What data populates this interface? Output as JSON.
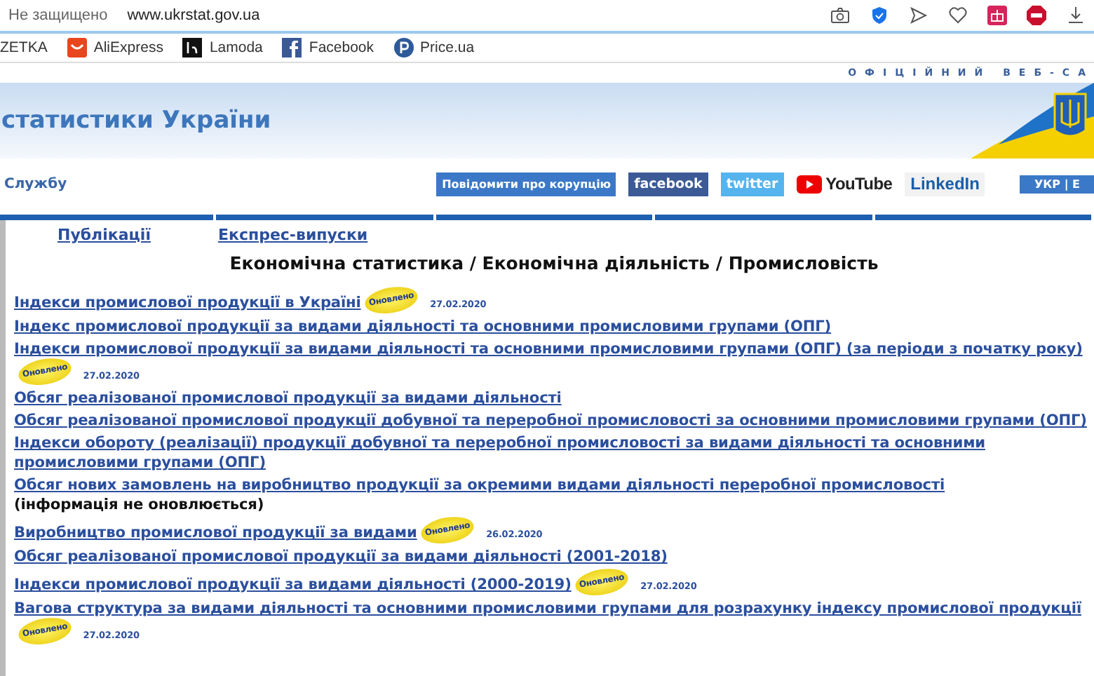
{
  "browser": {
    "security": "Не защищено",
    "url": "www.ukrstat.gov.ua",
    "bookmarks": [
      {
        "label": "ZETKA",
        "kind": "none"
      },
      {
        "label": "AliExpress",
        "kind": "ali"
      },
      {
        "label": "Lamoda",
        "kind": "lamoda"
      },
      {
        "label": "Facebook",
        "kind": "facebook"
      },
      {
        "label": "Price.ua",
        "kind": "price"
      }
    ]
  },
  "header": {
    "tagline": "ОФІЦІЙНИЙ ВЕБ-СА",
    "site_title": "статистики України",
    "service_link": "Службу",
    "social": [
      {
        "label": "Повідомити про корупцію",
        "kind": "corruption"
      },
      {
        "label": "facebook",
        "kind": "facebook"
      },
      {
        "label": "twitter",
        "kind": "twitter"
      },
      {
        "label": "YouTube",
        "kind": "youtube"
      },
      {
        "label": "LinkedIn",
        "kind": "linkedin"
      }
    ],
    "language": {
      "label": "УКР | Е",
      "selected": true
    }
  },
  "tabs": [
    {
      "label": "Публікації"
    },
    {
      "label": "Експрес-випуски"
    }
  ],
  "page_title": "Економічна статистика / Економічна діяльність / Промисловість",
  "items": [
    {
      "text": "Індекси промислової продукції в Україні",
      "badge": "Оновлено",
      "date": "27.02.2020"
    },
    {
      "text": "Індекс промислової продукції за видами діяльності та основними промисловими групами (ОПГ)"
    },
    {
      "text": "Індекси промислової продукції за видами діяльності та основними промисловими групами (ОПГ) (за періоди з початку року)",
      "badge": "Оновлено",
      "date": "27.02.2020"
    },
    {
      "text": "Обсяг реалізованої промислової продукції за видами діяльності"
    },
    {
      "text": "Обсяг реалізованої промислової продукції добувної та переробної промисловості за основними промисловими групами (ОПГ)"
    },
    {
      "text": "Індекси обороту (реалізації) продукції добувної та переробної промисловості за видами діяльності та основними промисловими групами (ОПГ)"
    },
    {
      "text": "Обсяг нових замовлень на виробництво продукції за окремими видами діяльності переробної промисловості",
      "note": "(інформація не оновлюється)"
    },
    {
      "text": "Виробництво промислової продукції за видами",
      "badge": "Оновлено",
      "date": "26.02.2020"
    },
    {
      "text": "Обсяг реалізованої промислової продукції за видами діяльності (2001-2018)"
    },
    {
      "text": "Індекси промислової продукції за видами діяльності (2000-2019)",
      "badge": "Оновлено",
      "date": "27.02.2020"
    },
    {
      "text": "Вагова структура за видами діяльності та основними промисловими групами для розрахунку індексу промислової продукції",
      "badge": "Оновлено",
      "date": "27.02.2020"
    }
  ]
}
